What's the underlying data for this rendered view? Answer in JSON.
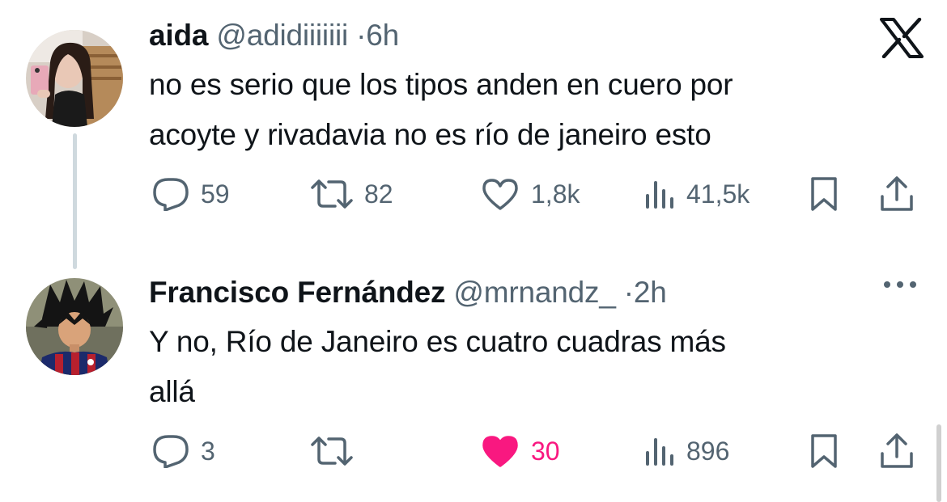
{
  "tweets": [
    {
      "author_name": "aida",
      "handle": "@adidiiiiiii",
      "separator": "·",
      "time": "6h",
      "text_lines": [
        "no es serio que los tipos anden en cuero por",
        "acoyte y rivadavia no es río de janeiro esto"
      ],
      "metrics": {
        "replies": "59",
        "reposts": "82",
        "likes": "1,8k",
        "views": "41,5k"
      },
      "liked": false
    },
    {
      "author_name": "Francisco Fernández",
      "handle": "@mrnandz_",
      "separator": "·",
      "time": "2h",
      "text_lines": [
        "Y no, Río de Janeiro es cuatro cuadras más",
        "allá"
      ],
      "metrics": {
        "replies": "3",
        "reposts": "",
        "likes": "30",
        "views": "896"
      },
      "liked": true
    }
  ],
  "colors": {
    "text": "#0f1419",
    "secondary": "#536471",
    "like_pink": "#f91880",
    "thread_line": "#cfd9de"
  },
  "icons": [
    "x-logo-icon",
    "reply-icon",
    "repost-icon",
    "like-icon",
    "views-icon",
    "bookmark-icon",
    "share-icon",
    "more-icon"
  ]
}
